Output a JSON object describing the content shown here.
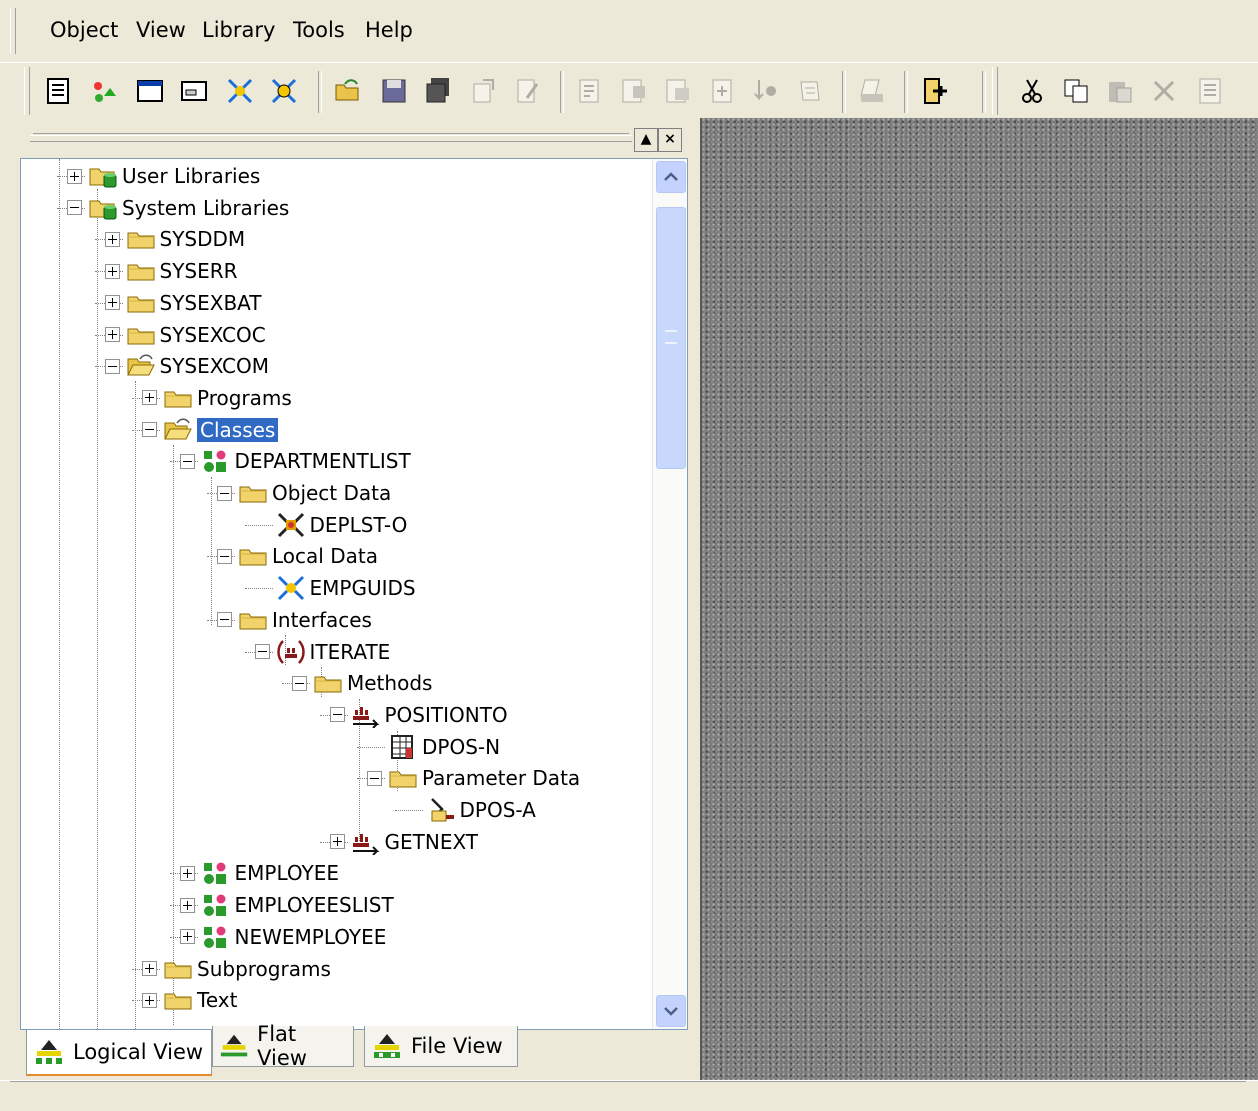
{
  "menu": {
    "items": [
      "Object",
      "View",
      "Library",
      "Tools",
      "Help"
    ]
  },
  "toolbar": {
    "buttons": [
      "list-icon",
      "properties-icon",
      "window-icon",
      "dialog-icon",
      "dataarea-icon",
      "dataarea-active-icon",
      "open-icon",
      "save-icon",
      "save-all-icon",
      "stow-icon",
      "edit-icon",
      "check-icon",
      "compile-icon",
      "run-icon",
      "debug-icon",
      "step-icon",
      "catalog-icon",
      "print-icon",
      "exit-icon",
      "cut-icon",
      "copy-icon",
      "paste-icon",
      "delete-icon",
      "list-icon-2"
    ]
  },
  "tree": {
    "nodes": [
      {
        "label": "User Libraries",
        "level": 0,
        "expanded": false,
        "icon": "library-db-icon"
      },
      {
        "label": "System Libraries",
        "level": 0,
        "expanded": true,
        "icon": "library-db-icon"
      },
      {
        "label": "SYSDDM",
        "level": 1,
        "expanded": false,
        "icon": "folder-icon"
      },
      {
        "label": "SYSERR",
        "level": 1,
        "expanded": false,
        "icon": "folder-icon"
      },
      {
        "label": "SYSEXBAT",
        "level": 1,
        "expanded": false,
        "icon": "folder-icon"
      },
      {
        "label": "SYSEXCOC",
        "level": 1,
        "expanded": false,
        "icon": "folder-icon"
      },
      {
        "label": "SYSEXCOM",
        "level": 1,
        "expanded": true,
        "icon": "folder-open-icon"
      },
      {
        "label": "Programs",
        "level": 2,
        "expanded": false,
        "icon": "folder-icon"
      },
      {
        "label": "Classes",
        "level": 2,
        "expanded": true,
        "icon": "folder-open-icon",
        "selected": true
      },
      {
        "label": "DEPARTMENTLIST",
        "level": 3,
        "expanded": true,
        "icon": "class-icon"
      },
      {
        "label": "Object Data",
        "level": 4,
        "expanded": true,
        "icon": "folder-icon"
      },
      {
        "label": "DEPLST-O",
        "level": 5,
        "leaf": true,
        "icon": "data-area-icon"
      },
      {
        "label": "Local Data",
        "level": 4,
        "expanded": true,
        "icon": "folder-icon"
      },
      {
        "label": "EMPGUIDS",
        "level": 5,
        "leaf": true,
        "icon": "local-data-icon"
      },
      {
        "label": "Interfaces",
        "level": 4,
        "expanded": true,
        "icon": "folder-icon"
      },
      {
        "label": "ITERATE",
        "level": 5,
        "expanded": true,
        "icon": "interface-icon"
      },
      {
        "label": "Methods",
        "level": 6,
        "expanded": true,
        "icon": "folder-icon"
      },
      {
        "label": "POSITIONTO",
        "level": 7,
        "expanded": true,
        "icon": "method-icon"
      },
      {
        "label": "DPOS-N",
        "level": 8,
        "leaf": true,
        "icon": "grid-icon"
      },
      {
        "label": "Parameter Data",
        "level": 8,
        "expanded": true,
        "icon": "folder-icon"
      },
      {
        "label": "DPOS-A",
        "level": 9,
        "leaf": true,
        "icon": "parameter-icon"
      },
      {
        "label": "GETNEXT",
        "level": 7,
        "expanded": false,
        "icon": "method-icon"
      },
      {
        "label": "EMPLOYEE",
        "level": 3,
        "expanded": false,
        "icon": "class-icon"
      },
      {
        "label": "EMPLOYEESLIST",
        "level": 3,
        "expanded": false,
        "icon": "class-icon"
      },
      {
        "label": "NEWEMPLOYEE",
        "level": 3,
        "expanded": false,
        "icon": "class-icon"
      },
      {
        "label": "Subprograms",
        "level": 2,
        "expanded": false,
        "icon": "folder-icon"
      },
      {
        "label": "Text",
        "level": 2,
        "expanded": false,
        "icon": "folder-icon"
      }
    ]
  },
  "tabs": [
    {
      "label": "Logical View",
      "active": true,
      "icon": "logical-view-icon"
    },
    {
      "label": "Flat View",
      "active": false,
      "icon": "flat-view-icon"
    },
    {
      "label": "File View",
      "active": false,
      "icon": "file-view-icon"
    }
  ],
  "colors": {
    "selection": "#316ac5",
    "folder": "#f2d36b",
    "workspace": "#7a7a7a"
  }
}
